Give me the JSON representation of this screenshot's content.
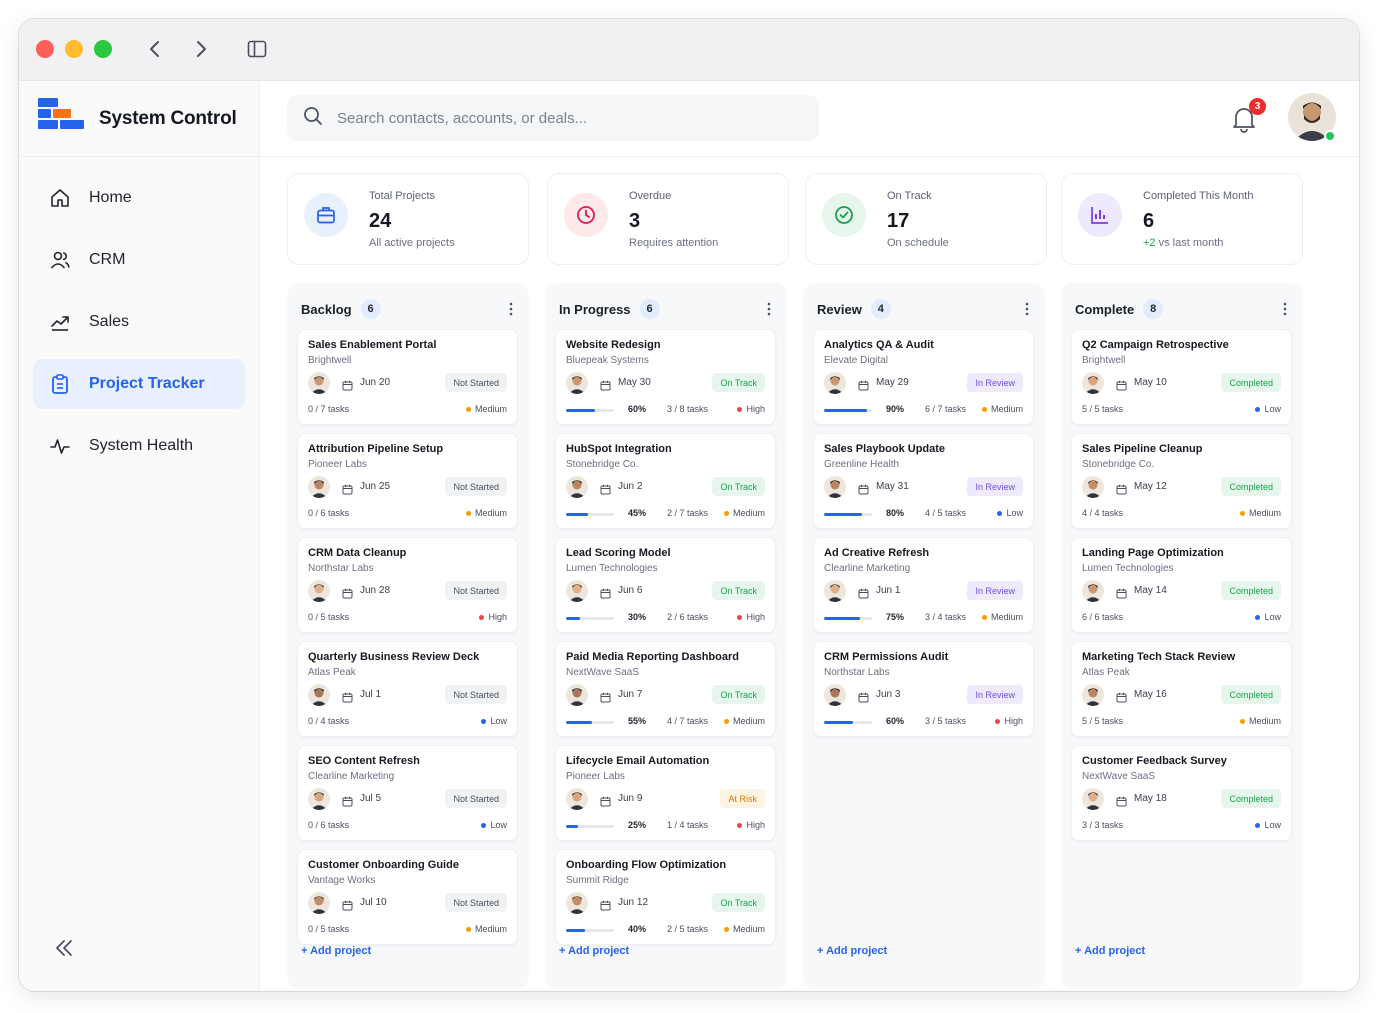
{
  "brand": {
    "name": "System Control"
  },
  "search": {
    "placeholder": "Search contacts, accounts, or deals..."
  },
  "notifications": {
    "count": "3"
  },
  "nav": [
    {
      "label": "Home",
      "icon": "home-icon"
    },
    {
      "label": "CRM",
      "icon": "users-icon"
    },
    {
      "label": "Sales",
      "icon": "trend-icon"
    },
    {
      "label": "Project Tracker",
      "icon": "clipboard-icon",
      "active": true
    },
    {
      "label": "System Health",
      "icon": "pulse-icon"
    }
  ],
  "stats": [
    {
      "label": "Total Projects",
      "value": "24",
      "sub": "All active projects",
      "icon": "briefcase-icon",
      "color": "#2563eb",
      "bg": "#e8f0fe"
    },
    {
      "label": "Overdue",
      "value": "3",
      "sub": "Requires attention",
      "icon": "clock-icon",
      "color": "#e11d48",
      "bg": "#fde8ea"
    },
    {
      "label": "On Track",
      "value": "17",
      "sub": "On schedule",
      "icon": "check-circle-icon",
      "color": "#16a34a",
      "bg": "#e6f6ec"
    },
    {
      "label": "Completed This Month",
      "value": "6",
      "sub_pos": "+2",
      "sub": " vs last month",
      "icon": "bar-chart-icon",
      "color": "#7c3aed",
      "bg": "#efe9fd"
    }
  ],
  "add_label": "+ Add project",
  "columns": [
    {
      "title": "Backlog",
      "count": "6",
      "cards": [
        {
          "title": "Sales Enablement Portal",
          "org": "Brightwell",
          "date": "Jun 20",
          "status": "Not Started",
          "kind": "ns",
          "tasks": "0 / 7 tasks",
          "priority": "Medium"
        },
        {
          "title": "Attribution Pipeline Setup",
          "org": "Pioneer Labs",
          "date": "Jun 25",
          "status": "Not Started",
          "kind": "ns",
          "tasks": "0 / 6 tasks",
          "priority": "Medium"
        },
        {
          "title": "CRM Data Cleanup",
          "org": "Northstar Labs",
          "date": "Jun 28",
          "status": "Not Started",
          "kind": "ns",
          "tasks": "0 / 5 tasks",
          "priority": "High"
        },
        {
          "title": "Quarterly Business Review Deck",
          "org": "Atlas Peak",
          "date": "Jul 1",
          "status": "Not Started",
          "kind": "ns",
          "tasks": "0 / 4 tasks",
          "priority": "Low"
        },
        {
          "title": "SEO Content Refresh",
          "org": "Clearline Marketing",
          "date": "Jul 5",
          "status": "Not Started",
          "kind": "ns",
          "tasks": "0 / 6 tasks",
          "priority": "Low"
        },
        {
          "title": "Customer Onboarding Guide",
          "org": "Vantage Works",
          "date": "Jul 10",
          "status": "Not Started",
          "kind": "ns",
          "tasks": "0 / 5 tasks",
          "priority": "Medium"
        }
      ]
    },
    {
      "title": "In Progress",
      "count": "6",
      "cards": [
        {
          "title": "Website Redesign",
          "org": "Bluepeak Systems",
          "date": "May 30",
          "status": "On Track",
          "kind": "ot",
          "progress": 60,
          "pct": "60%",
          "tasks": "3 / 8 tasks",
          "priority": "High"
        },
        {
          "title": "HubSpot Integration",
          "org": "Stonebridge Co.",
          "date": "Jun 2",
          "status": "On Track",
          "kind": "ot",
          "progress": 45,
          "pct": "45%",
          "tasks": "2 / 7 tasks",
          "priority": "Medium"
        },
        {
          "title": "Lead Scoring Model",
          "org": "Lumen Technologies",
          "date": "Jun 6",
          "status": "On Track",
          "kind": "ot",
          "progress": 30,
          "pct": "30%",
          "tasks": "2 / 6 tasks",
          "priority": "High"
        },
        {
          "title": "Paid Media Reporting Dashboard",
          "org": "NextWave SaaS",
          "date": "Jun 7",
          "status": "On Track",
          "kind": "ot",
          "progress": 55,
          "pct": "55%",
          "tasks": "4 / 7 tasks",
          "priority": "Medium"
        },
        {
          "title": "Lifecycle Email Automation",
          "org": "Pioneer Labs",
          "date": "Jun 9",
          "status": "At Risk",
          "kind": "ar",
          "progress": 25,
          "pct": "25%",
          "tasks": "1 / 4 tasks",
          "priority": "High"
        },
        {
          "title": "Onboarding Flow Optimization",
          "org": "Summit Ridge",
          "date": "Jun 12",
          "status": "On Track",
          "kind": "ot",
          "progress": 40,
          "pct": "40%",
          "tasks": "2 / 5 tasks",
          "priority": "Medium"
        }
      ]
    },
    {
      "title": "Review",
      "count": "4",
      "cards": [
        {
          "title": "Analytics QA & Audit",
          "org": "Elevate Digital",
          "date": "May 29",
          "status": "In Review",
          "kind": "ir",
          "progress": 90,
          "pct": "90%",
          "tasks": "6 / 7 tasks",
          "priority": "Medium"
        },
        {
          "title": "Sales Playbook Update",
          "org": "Greenline Health",
          "date": "May 31",
          "status": "In Review",
          "kind": "ir",
          "progress": 80,
          "pct": "80%",
          "tasks": "4 / 5 tasks",
          "priority": "Low"
        },
        {
          "title": "Ad Creative Refresh",
          "org": "Clearline Marketing",
          "date": "Jun 1",
          "status": "In Review",
          "kind": "ir",
          "progress": 75,
          "pct": "75%",
          "tasks": "3 / 4 tasks",
          "priority": "Medium"
        },
        {
          "title": "CRM Permissions Audit",
          "org": "Northstar Labs",
          "date": "Jun 3",
          "status": "In Review",
          "kind": "ir",
          "progress": 60,
          "pct": "60%",
          "tasks": "3 / 5 tasks",
          "priority": "High"
        }
      ]
    },
    {
      "title": "Complete",
      "count": "8",
      "cards": [
        {
          "title": "Q2 Campaign Retrospective",
          "org": "Brightwell",
          "date": "May 10",
          "status": "Completed",
          "kind": "cp",
          "tasks": "5 / 5 tasks",
          "priority": "Low"
        },
        {
          "title": "Sales Pipeline Cleanup",
          "org": "Stonebridge Co.",
          "date": "May 12",
          "status": "Completed",
          "kind": "cp",
          "tasks": "4 / 4 tasks",
          "priority": "Medium"
        },
        {
          "title": "Landing Page Optimization",
          "org": "Lumen Technologies",
          "date": "May 14",
          "status": "Completed",
          "kind": "cp",
          "tasks": "6 / 6 tasks",
          "priority": "Low"
        },
        {
          "title": "Marketing Tech Stack Review",
          "org": "Atlas Peak",
          "date": "May 16",
          "status": "Completed",
          "kind": "cp",
          "tasks": "5 / 5 tasks",
          "priority": "Medium"
        },
        {
          "title": "Customer Feedback Survey",
          "org": "NextWave SaaS",
          "date": "May 18",
          "status": "Completed",
          "kind": "cp",
          "tasks": "3 / 3 tasks",
          "priority": "Low"
        }
      ]
    }
  ],
  "priority_colors": {
    "High": "#ef4444",
    "Medium": "#f59e0b",
    "Low": "#2563eb"
  }
}
